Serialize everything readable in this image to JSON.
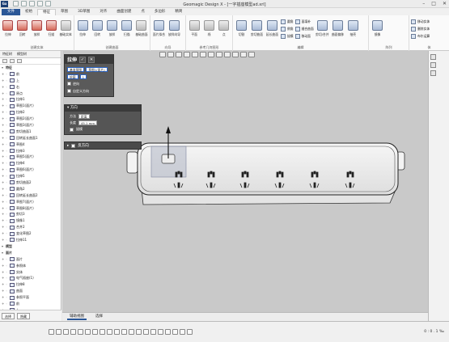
{
  "app": {
    "logo": "Gx",
    "window_title": "Geomagic Design X - [一字插座模型ad.xrl]"
  },
  "window_controls": [
    "–",
    "□",
    "✕"
  ],
  "ribbon_tabs": [
    "文件",
    "初始",
    "特征",
    "草图",
    "3D草图",
    "对齐",
    "曲面创建",
    "点",
    "多边形",
    "精简"
  ],
  "ribbon": {
    "group1_label": "创建实体",
    "group1_buttons": [
      "拉伸",
      "回转",
      "放样",
      "扫描",
      "基础实体"
    ],
    "group2_label": "创建曲面",
    "group2_buttons": [
      "拉伸",
      "回转",
      "放样",
      "扫描",
      "基础曲面"
    ],
    "group3_label": "向导",
    "group3_buttons": [
      "面片拟合",
      "放样向导"
    ],
    "group4_label": "参考几何图形",
    "group4_buttons": [
      "平面",
      "线",
      "点"
    ],
    "group5_label": "编辑",
    "group5_buttons": [
      "切割",
      "剪切曲面",
      "延长曲面"
    ],
    "group5_small": [
      "圆角",
      "倒角",
      "拔模",
      "面填补",
      "缝合曲面",
      "移动面"
    ],
    "group5_buttons2": [
      "剪切/合并",
      "曲面偏移",
      "抽壳"
    ],
    "group6_label": "阵列",
    "group6_buttons": [
      "镜像"
    ],
    "group7_label": "体",
    "group7_small": [
      "移动实体",
      "删除实体",
      "布尔运算"
    ]
  },
  "left_panel": {
    "tabs": [
      "特征树",
      "模型树"
    ],
    "tree": [
      {
        "label": "特征",
        "type": "header"
      },
      {
        "label": "前"
      },
      {
        "label": "上"
      },
      {
        "label": "右"
      },
      {
        "label": "原点"
      },
      {
        "label": "拉伸1"
      },
      {
        "label": "草图1(面片)"
      },
      {
        "label": "拉伸2"
      },
      {
        "label": "草图2(面片)"
      },
      {
        "label": "草图3(面片)"
      },
      {
        "label": "剪切曲面1"
      },
      {
        "label": "回转延长曲面1"
      },
      {
        "label": "草图4"
      },
      {
        "label": "拉伸3"
      },
      {
        "label": "草图5(面片)"
      },
      {
        "label": "拉伸4"
      },
      {
        "label": "草图6(面片)"
      },
      {
        "label": "拉伸5"
      },
      {
        "label": "剪切曲面2"
      },
      {
        "label": "圆角2"
      },
      {
        "label": "回转延长曲面2"
      },
      {
        "label": "草图7(面片)"
      },
      {
        "label": "草图8(面片)"
      },
      {
        "label": "剪切3"
      },
      {
        "label": "镜像1"
      },
      {
        "label": "合并2"
      },
      {
        "label": "变化草图2"
      },
      {
        "label": "拉伸11"
      },
      {
        "label": "模型",
        "type": "header"
      },
      {
        "label": "面片",
        "type": "header"
      },
      {
        "label": "面片"
      },
      {
        "label": "参照体"
      },
      {
        "label": "实体"
      },
      {
        "label": "电气插座(1)"
      },
      {
        "label": "拉伸8"
      },
      {
        "label": "曲面"
      },
      {
        "label": "参照平面"
      },
      {
        "label": "前"
      },
      {
        "label": "上"
      },
      {
        "label": "右"
      }
    ],
    "bottom_buttons": [
      "选择",
      "隐藏"
    ]
  },
  "dialog": {
    "title": "拉伸",
    "ok": "✓",
    "cancel": "✕",
    "row1_label": "基准草图",
    "row1_value": "草图1(面片)",
    "row2_label": "轮廓",
    "row2_value": "1",
    "row3_label": "逆向",
    "row4_label": "自定义方向",
    "direction_header": "方向",
    "method_label": "方法",
    "method_value": "距离",
    "length_label": "长度",
    "length_value": "45.1 mm",
    "draft_label": "拔模",
    "reverse_header": "反方向"
  },
  "viewport_bottom_tabs": [
    "辅助视图",
    "选择"
  ],
  "status_bar": {
    "text": "0 : 0 . 1 ‰"
  }
}
